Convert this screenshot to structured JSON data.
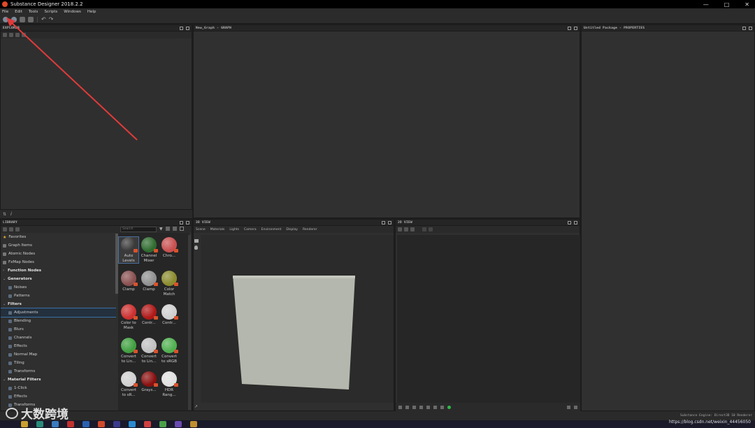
{
  "window": {
    "title": "Substance Designer 2018.2.2",
    "controls": [
      "—",
      "□",
      "✕"
    ]
  },
  "menu": [
    "File",
    "Edit",
    "Tools",
    "Scripts",
    "Windows",
    "Help"
  ],
  "toolbar": {
    "icons": [
      "new-package-icon",
      "new-graph-icon",
      "open-icon",
      "save-icon",
      "undo-icon",
      "redo-icon"
    ]
  },
  "panels": {
    "explorer": {
      "title": "EXPLORER"
    },
    "graph": {
      "title": "New_Graph - GRAPH"
    },
    "properties": {
      "title": "Untitled Package - PROPERTIES"
    },
    "library": {
      "title": "LIBRARY",
      "search_placeholder": "Search"
    },
    "view3d": {
      "title": "3D VIEW",
      "menu": [
        "Scene",
        "Materials",
        "Lights",
        "Camera",
        "Environment",
        "Display",
        "Renderer"
      ]
    },
    "view2d": {
      "title": "2D VIEW"
    }
  },
  "library_tree": [
    {
      "label": "Favorites",
      "level": 0,
      "kind": "favorites"
    },
    {
      "label": "Graph Items",
      "level": 0,
      "kind": "item"
    },
    {
      "label": "Atomic Nodes",
      "level": 0,
      "kind": "item"
    },
    {
      "label": "FxMap Nodes",
      "level": 0,
      "kind": "item"
    },
    {
      "label": "Function Nodes",
      "level": 0,
      "kind": "bold",
      "arrow": "›"
    },
    {
      "label": "Generators",
      "level": 0,
      "kind": "bold",
      "arrow": "⌄"
    },
    {
      "label": "Noises",
      "level": 1,
      "kind": "sub"
    },
    {
      "label": "Patterns",
      "level": 1,
      "kind": "sub"
    },
    {
      "label": "Filters",
      "level": 0,
      "kind": "bold",
      "arrow": "⌄"
    },
    {
      "label": "Adjustments",
      "level": 1,
      "kind": "sub",
      "selected": true
    },
    {
      "label": "Blending",
      "level": 1,
      "kind": "sub"
    },
    {
      "label": "Blurs",
      "level": 1,
      "kind": "sub"
    },
    {
      "label": "Channels",
      "level": 1,
      "kind": "sub"
    },
    {
      "label": "Effects",
      "level": 1,
      "kind": "sub"
    },
    {
      "label": "Normal Map",
      "level": 1,
      "kind": "sub"
    },
    {
      "label": "Tiling",
      "level": 1,
      "kind": "sub"
    },
    {
      "label": "Transforms",
      "level": 1,
      "kind": "sub"
    },
    {
      "label": "Material Filters",
      "level": 0,
      "kind": "bold",
      "arrow": "⌄"
    },
    {
      "label": "1-Click",
      "level": 1,
      "kind": "sub"
    },
    {
      "label": "Effects",
      "level": 1,
      "kind": "sub"
    },
    {
      "label": "Transforms",
      "level": 1,
      "kind": "sub"
    }
  ],
  "library_nodes": [
    {
      "label": "Auto Levels",
      "color": "#3a3a3a",
      "selected": true
    },
    {
      "label": "Channel Mixer",
      "color": "#2f6b2f"
    },
    {
      "label": "Chro...",
      "color": "#c85050"
    },
    {
      "label": "Clamp",
      "color": "#8a5050"
    },
    {
      "label": "Clamp",
      "color": "#909090"
    },
    {
      "label": "Color Match",
      "color": "#8b8b2f"
    },
    {
      "label": "Color to Mask",
      "color": "#cc3030"
    },
    {
      "label": "Contr...",
      "color": "#b01818"
    },
    {
      "label": "Contr...",
      "color": "#d0d0d0"
    },
    {
      "label": "Convert to Lin...",
      "color": "#40a040"
    },
    {
      "label": "Convert to Lin...",
      "color": "#c0c0c0"
    },
    {
      "label": "Convert to sRGB",
      "color": "#50b050"
    },
    {
      "label": "Convert to sR...",
      "color": "#d0d0d0"
    },
    {
      "label": "Grays...",
      "color": "#8a1010"
    },
    {
      "label": "HDR Rang...",
      "color": "#e0e0e0"
    }
  ],
  "status": {
    "engine": "Substance Engine: Direct3D 10 Renderer"
  },
  "watermark": {
    "text": "大数跨境",
    "url": "https://blog.csdn.net/weixin_44456050"
  },
  "colors": {
    "accent": "#3a6fa8",
    "arrow": "#e23a3a",
    "badge": "#d9532c"
  }
}
